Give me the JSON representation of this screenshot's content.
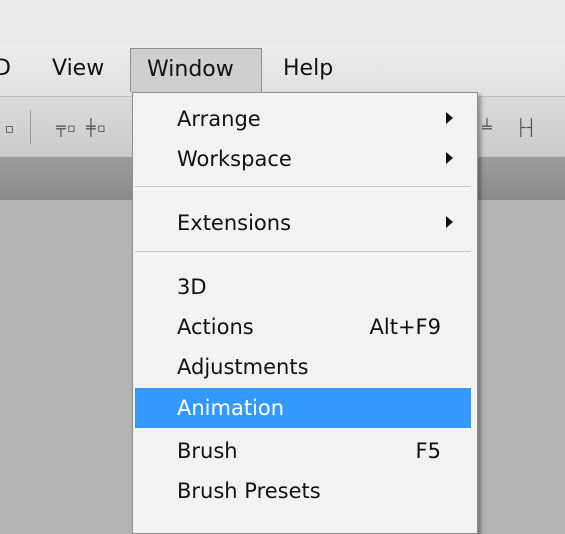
{
  "menubar": {
    "items": [
      {
        "label": "D"
      },
      {
        "label": "View"
      },
      {
        "label": "Window"
      },
      {
        "label": "Help"
      }
    ]
  },
  "toolbar": {
    "icons": [
      "align-top-icon",
      "align-vertical-center-icon",
      "align-bottom-icon",
      "distribute-icon"
    ]
  },
  "window_menu": {
    "items": [
      {
        "label": "Arrange",
        "submenu": true
      },
      {
        "label": "Workspace",
        "submenu": true
      },
      {
        "label": "Extensions",
        "submenu": true
      },
      {
        "label": "3D"
      },
      {
        "label": "Actions",
        "shortcut": "Alt+F9"
      },
      {
        "label": "Adjustments"
      },
      {
        "label": "Animation",
        "highlighted": true
      },
      {
        "label": "Brush",
        "shortcut": "F5"
      },
      {
        "label": "Brush Presets"
      }
    ]
  },
  "colors": {
    "highlight": "#3399ff",
    "menu_bg": "#f2f2f2"
  }
}
